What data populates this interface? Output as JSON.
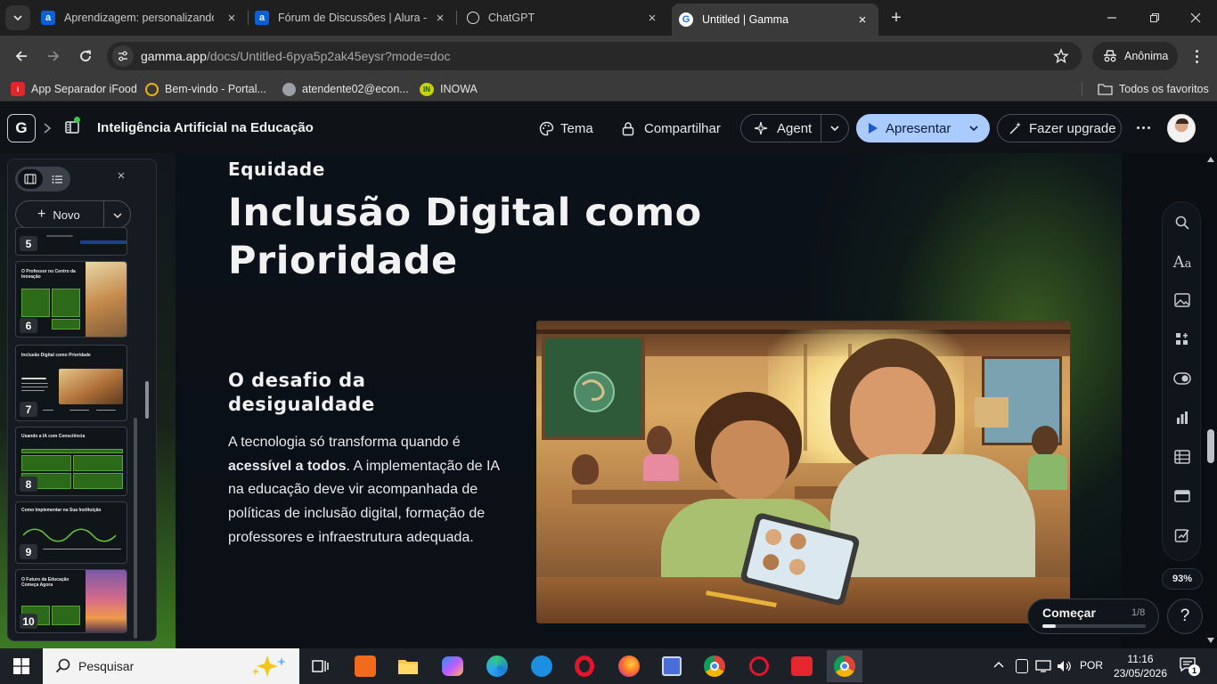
{
  "browser": {
    "tabs": [
      {
        "title": "Aprendizagem: personalizando",
        "favicon": "a",
        "color": "#0b5fd8"
      },
      {
        "title": "Fórum de Discussões | Alura - C",
        "favicon": "a",
        "color": "#0b5fd8"
      },
      {
        "title": "ChatGPT",
        "favicon": "chatgpt-icon",
        "color": "#ffffff"
      },
      {
        "title": "Untitled | Gamma",
        "favicon": "G",
        "color": "#1f6feb",
        "active": true
      }
    ],
    "url_host": "gamma.app",
    "url_path": "/docs/Untitled-6pya5p2ak45eysr?mode=doc",
    "profile_label": "Anônima",
    "bookmarks": [
      {
        "label": "App Separador iFood",
        "color": "#e2252b"
      },
      {
        "label": "Bem-vindo - Portal...",
        "color": "#f2b600"
      },
      {
        "label": "atendente02@econ...",
        "color": "#9aa0a6"
      },
      {
        "label": "INOWA",
        "color": "#c8d400"
      }
    ],
    "all_bookmarks_label": "Todos os favoritos"
  },
  "gamma": {
    "logo": "G",
    "doc_title": "Inteligência Artificial na Educação",
    "tema_label": "Tema",
    "share_label": "Compartilhar",
    "agent_label": "Agent",
    "present_label": "Apresentar",
    "upgrade_label": "Fazer upgrade",
    "accent": "#6aa7ff",
    "new_label": "Novo",
    "slides": [
      {
        "num": "5"
      },
      {
        "num": "6",
        "title": "O Professor no Centro da Inovação"
      },
      {
        "num": "7",
        "title": "Inclusão Digital como Prioridade"
      },
      {
        "num": "8",
        "title": "Usando a IA com Consciência"
      },
      {
        "num": "9",
        "title": "Como Implementar na Sua Instituição"
      },
      {
        "num": "10",
        "title": "O Futuro da Educação Começa Agora"
      }
    ],
    "card": {
      "eyebrow": "Equidade",
      "heading_line1": "Inclusão Digital como",
      "heading_line2": "Prioridade",
      "subheading_line1": "O desafio da",
      "subheading_line2": "desigualdade",
      "body_pre": "A tecnologia só transforma quando é ",
      "body_bold": "acessível a todos",
      "body_post": ". A implementação de IA na educação deve vir acompanhada de políticas de inclusão digital, formação de professores e infraestrutura adequada."
    },
    "zoom": "93%",
    "start": {
      "label": "Começar",
      "progress": "1/8",
      "progress_fraction": 0.125
    },
    "help": "?"
  },
  "taskbar": {
    "search_placeholder": "Pesquisar",
    "lang": "POR",
    "time": "11:16",
    "date": "23/05/2026",
    "notif_count": "1"
  }
}
